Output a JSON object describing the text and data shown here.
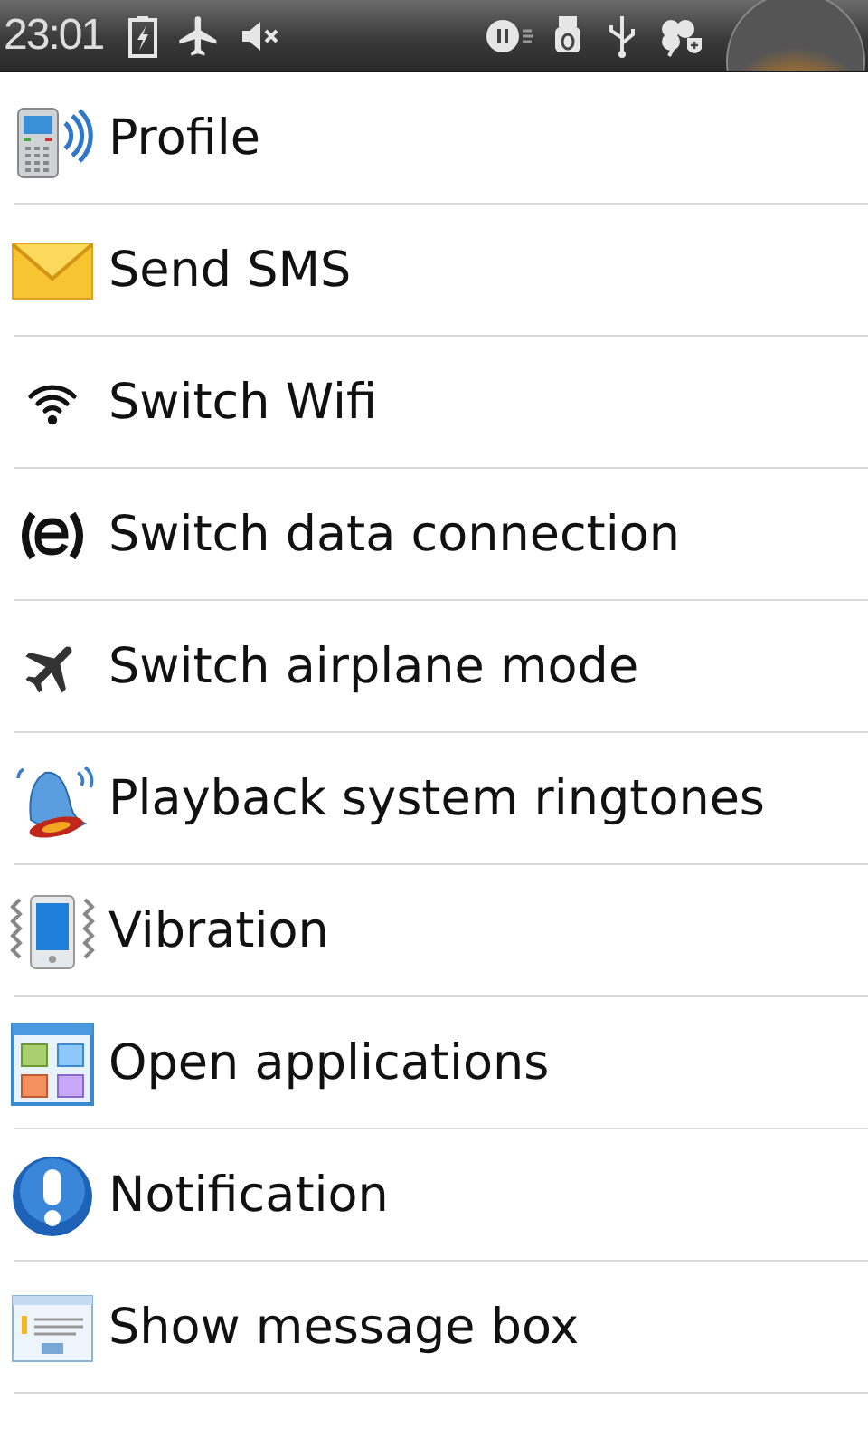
{
  "status_bar": {
    "time": "23:01"
  },
  "items": [
    {
      "label": "Profile"
    },
    {
      "label": "Send SMS"
    },
    {
      "label": "Switch Wifi"
    },
    {
      "label": "Switch data connection"
    },
    {
      "label": "Switch airplane mode"
    },
    {
      "label": "Playback system ringtones"
    },
    {
      "label": "Vibration"
    },
    {
      "label": "Open applications"
    },
    {
      "label": "Notification"
    },
    {
      "label": "Show message box"
    }
  ]
}
